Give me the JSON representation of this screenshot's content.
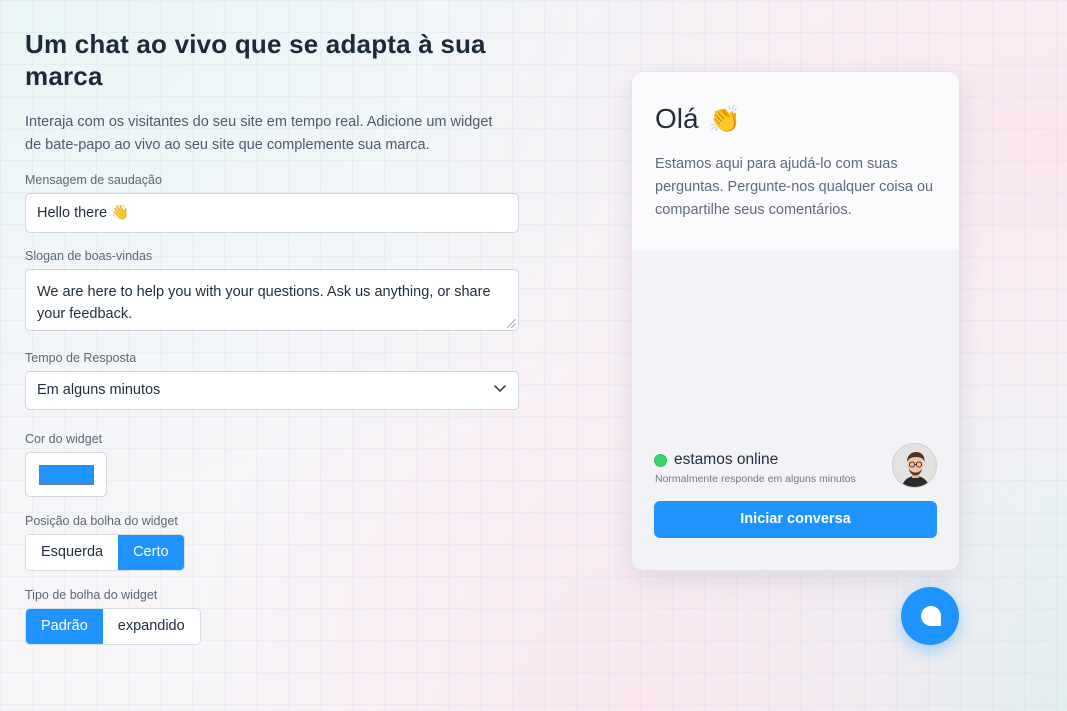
{
  "config": {
    "title": "Um chat ao vivo que se adapta à sua marca",
    "subtitle": "Interaja com os visitantes do seu site em tempo real. Adicione um widget de bate-papo ao vivo ao seu site que complemente sua marca.",
    "greeting_label": "Mensagem de saudação",
    "greeting_value": "Hello there 👋",
    "tagline_label": "Slogan de boas-vindas",
    "tagline_value": "We are here to help you with your questions. Ask us anything, or share your feedback.",
    "response_label": "Tempo de Resposta",
    "response_value": "Em alguns minutos",
    "color_label": "Cor do widget",
    "color_value": "#1f93ff",
    "position_label": "Posição da bolha do widget",
    "position_options": [
      "Esquerda",
      "Certo"
    ],
    "position_selected": "Certo",
    "bubble_type_label": "Tipo de bolha do widget",
    "bubble_type_options": [
      "Padrão",
      "expandido"
    ],
    "bubble_type_selected": "Padrão"
  },
  "widget": {
    "greeting": "Olá",
    "greeting_emoji": "👏",
    "intro": "Estamos aqui para ajudá-lo com suas perguntas. Pergunte-nos qualquer coisa ou compartilhe seus comentários.",
    "status": "estamos online",
    "response_note": "Normalmente responde em alguns minutos",
    "start_button": "Iniciar conversa",
    "status_color": "#3ad46b",
    "accent_color": "#1f93ff"
  },
  "icons": {
    "select_arrow": "chevron-down-icon",
    "bubble": "chat-bubble-icon",
    "avatar": "agent-avatar"
  }
}
